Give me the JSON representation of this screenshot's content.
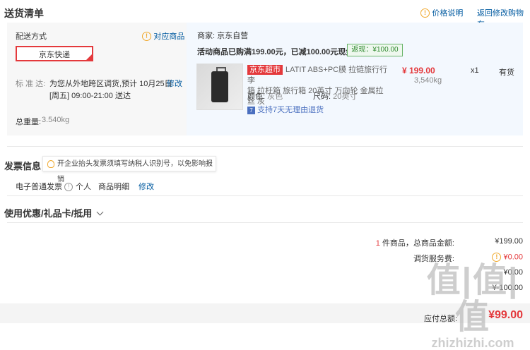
{
  "header": {
    "title": "送货清单",
    "price_note": "价格说明",
    "back_to_cart": "返回修改购物车"
  },
  "shipping": {
    "label": "配送方式",
    "corresponding_goods": "对应商品",
    "method": "京东快递",
    "standard_label": "标 准 达:",
    "standard_text": "为您从外地跨区调货,预计 10月25日",
    "standard_time": "[周五] 09:00-21:00 送达",
    "edit": "修改",
    "weight_label": "总重量:",
    "weight_value": "3.540kg"
  },
  "seller": {
    "label": "商家:",
    "name": "京东自营",
    "promo": "活动商品已购满199.00元，已减100.00元现金",
    "rebate": "返现：¥100.00"
  },
  "product": {
    "tag": "京东超市",
    "name_line1": "LATIT ABS+PC膜 拉链旅行行李",
    "name_line2": "箱 拉杆箱 旅行箱 20英寸 万向轮 金属拉丝 灰",
    "price": "¥ 199.00",
    "weight": "3,540kg",
    "qty": "x1",
    "stock": "有货",
    "color_label": "颜色:",
    "color_value": "灰色",
    "size_label": "尺码:",
    "size_value": "20英寸",
    "return_policy": "支持7天无理由退货"
  },
  "invoice": {
    "title": "发票信息",
    "tip": "开企业抬头发票须填写纳税人识别号，以免影响报销",
    "type": "电子普通发票",
    "personal": "个人",
    "detail": "商品明细",
    "edit": "修改"
  },
  "coupon": {
    "title": "使用优惠/礼品卡/抵用"
  },
  "summary": {
    "count": "1",
    "count_suffix": "件商品，总商品金额:",
    "total": "¥199.00",
    "service_label": "调货服务费:",
    "service_value": "¥0.00",
    "row3_value": "¥0.00",
    "row4_value": "¥-100.00",
    "payable_label": "应付总额:",
    "payable_value": "¥99.00"
  },
  "watermark": {
    "big": "值|值|值",
    "small": "zhizhizhi.com"
  }
}
